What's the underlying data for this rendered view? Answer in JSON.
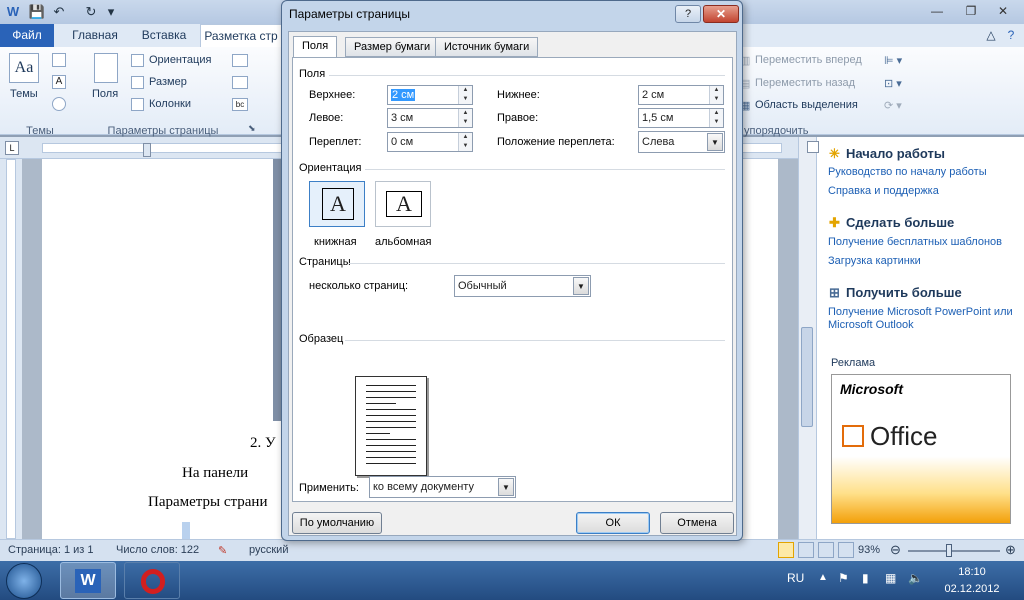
{
  "word": {
    "tabs": [
      "Файл",
      "Главная",
      "Вставка",
      "Разметка стр"
    ],
    "ribbon": {
      "themes_label": "Темы",
      "margins_label": "Поля",
      "orientation": "Ориентация",
      "size": "Размер",
      "columns": "Колонки",
      "group_themes": "Темы",
      "group_page_setup": "Параметры страницы",
      "bring_forward": "Переместить вперед",
      "send_backward": "Переместить назад",
      "selection_pane": "Область выделения",
      "group_arrange": "упорядочить"
    },
    "document": {
      "line1": "2.   У",
      "line2": "На    панели",
      "line3": "Параметры страни"
    },
    "taskpane": {
      "start_title": "Начало работы",
      "start_link1": "Руководство по началу работы",
      "start_link2": "Справка и поддержка",
      "more_title": "Сделать больше",
      "more_link1": "Получение бесплатных шаблонов",
      "more_link2": "Загрузка картинки",
      "get_title": "Получить больше",
      "get_link1": "Получение Microsoft PowerPoint или",
      "get_link2": "Microsoft Outlook",
      "ad_label": "Реклама",
      "ad_microsoft": "Microsoft",
      "ad_office": "Office"
    },
    "status": {
      "page": "Страница: 1 из 1",
      "words": "Число слов: 122",
      "lang": "русский",
      "zoom": "93%"
    }
  },
  "taskbar": {
    "lang": "RU",
    "time": "18:10",
    "date": "02.12.2012"
  },
  "dialog": {
    "title": "Параметры страницы",
    "help": "?",
    "close": "✕",
    "tabs": [
      "Поля",
      "Размер бумаги",
      "Источник бумаги"
    ],
    "margins_section": "Поля",
    "top_label": "Верхнее:",
    "top_value": "2 см",
    "bottom_label": "Нижнее:",
    "bottom_value": "2 см",
    "left_label": "Левое:",
    "left_value": "3 см",
    "right_label": "Правое:",
    "right_value": "1,5 см",
    "gutter_label": "Переплет:",
    "gutter_value": "0 см",
    "gutter_pos_label": "Положение переплета:",
    "gutter_pos_value": "Слева",
    "orientation_section": "Ориентация",
    "portrait": "книжная",
    "landscape": "альбомная",
    "glyph": "A",
    "pages_section": "Страницы",
    "multiple_pages_label": "несколько страниц:",
    "multiple_pages_value": "Обычный",
    "preview_section": "Образец",
    "apply_label": "Применить:",
    "apply_value": "ко всему документу",
    "default_button": "По умолчанию",
    "ok_button": "ОК",
    "cancel_button": "Отмена"
  }
}
